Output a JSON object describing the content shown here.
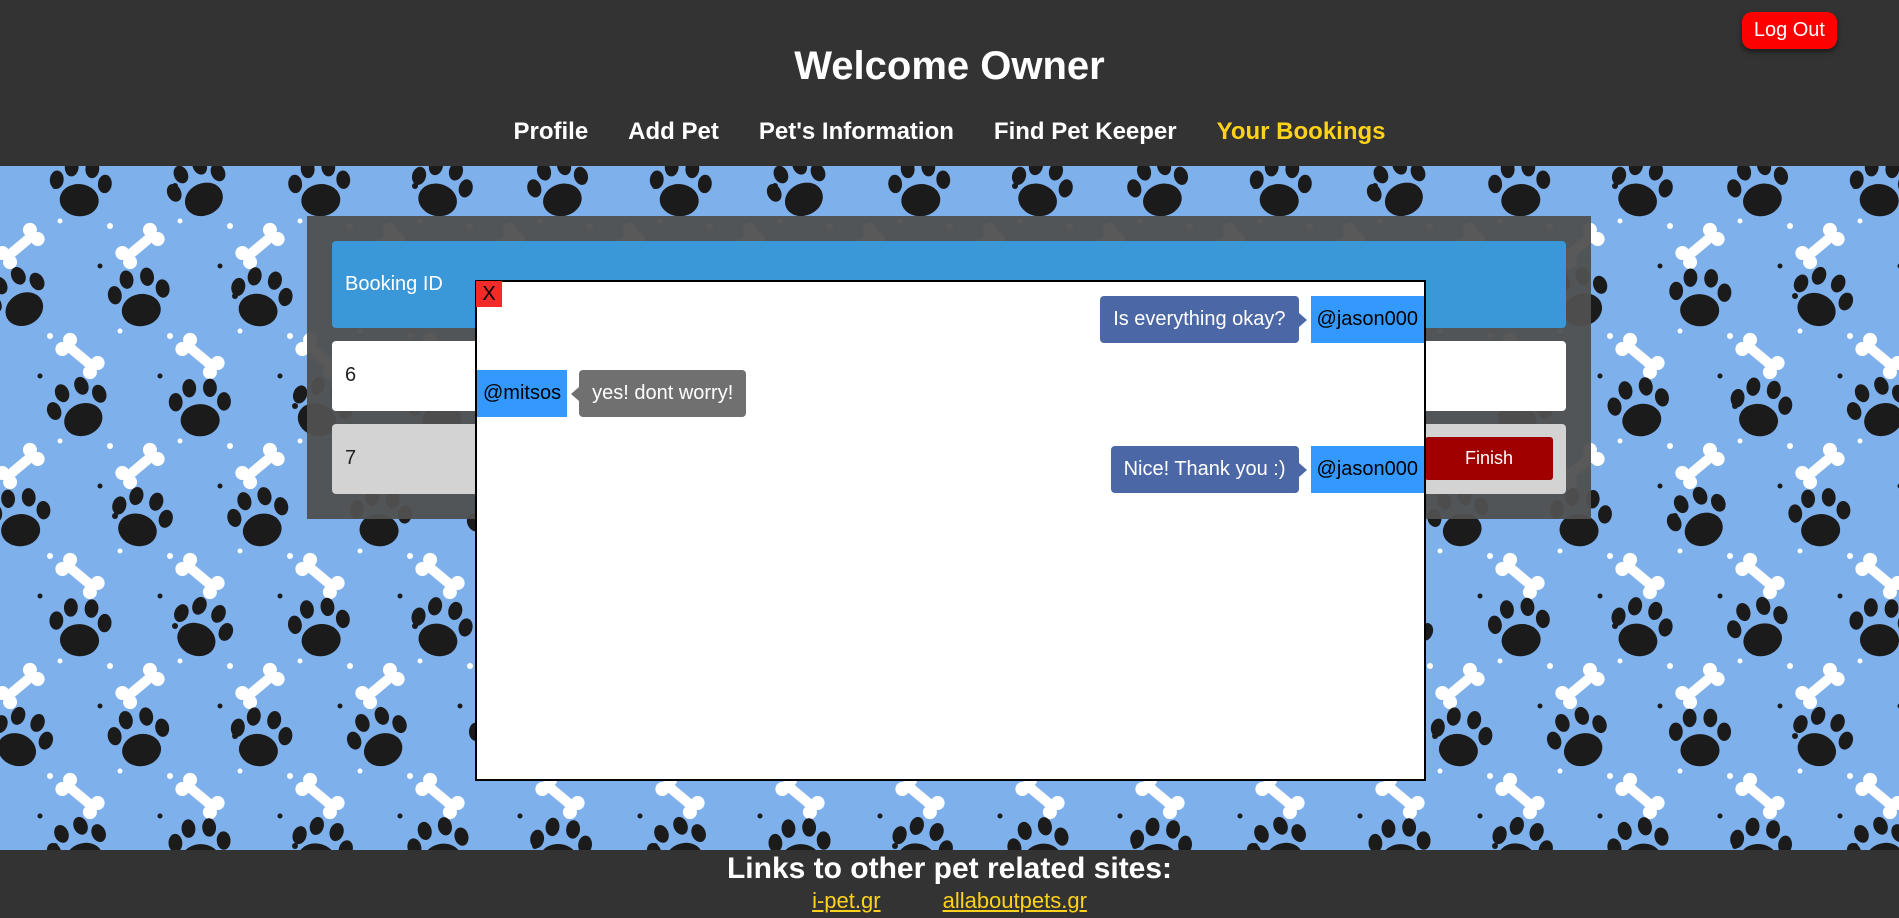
{
  "header": {
    "title": "Welcome Owner",
    "logout_label": "Log Out",
    "nav": [
      {
        "label": "Profile"
      },
      {
        "label": "Add Pet"
      },
      {
        "label": "Pet's Information"
      },
      {
        "label": "Find Pet Keeper"
      },
      {
        "label": "Your Bookings",
        "active": true
      }
    ]
  },
  "bookings": {
    "columns": [
      "Booking ID"
    ],
    "rows": [
      {
        "id": "6"
      },
      {
        "id": "7",
        "action_label": "Finish"
      }
    ]
  },
  "chat": {
    "close_label": "X",
    "messages": [
      {
        "side": "right",
        "user": "@jason000",
        "text": "Is everything okay?"
      },
      {
        "side": "left",
        "user": "@mitsos",
        "text": "yes! dont worry!"
      },
      {
        "side": "right",
        "user": "@jason000",
        "text": "Nice! Thank you :)"
      }
    ]
  },
  "footer": {
    "title": "Links to other pet related sites:",
    "links": [
      "i-pet.gr",
      "allaboutpets.gr"
    ]
  },
  "colors": {
    "header_bg": "#333333",
    "accent": "#ffd21a",
    "logout": "#ff0000",
    "table_head": "#3a97d8",
    "finish": "#a00000",
    "chat_mine": "#4b67a6",
    "chat_theirs": "#707070",
    "user_tag": "#3399ff",
    "pattern_bg": "#7eb0ec"
  },
  "icons": [
    "paw-print-icon",
    "bone-icon"
  ]
}
